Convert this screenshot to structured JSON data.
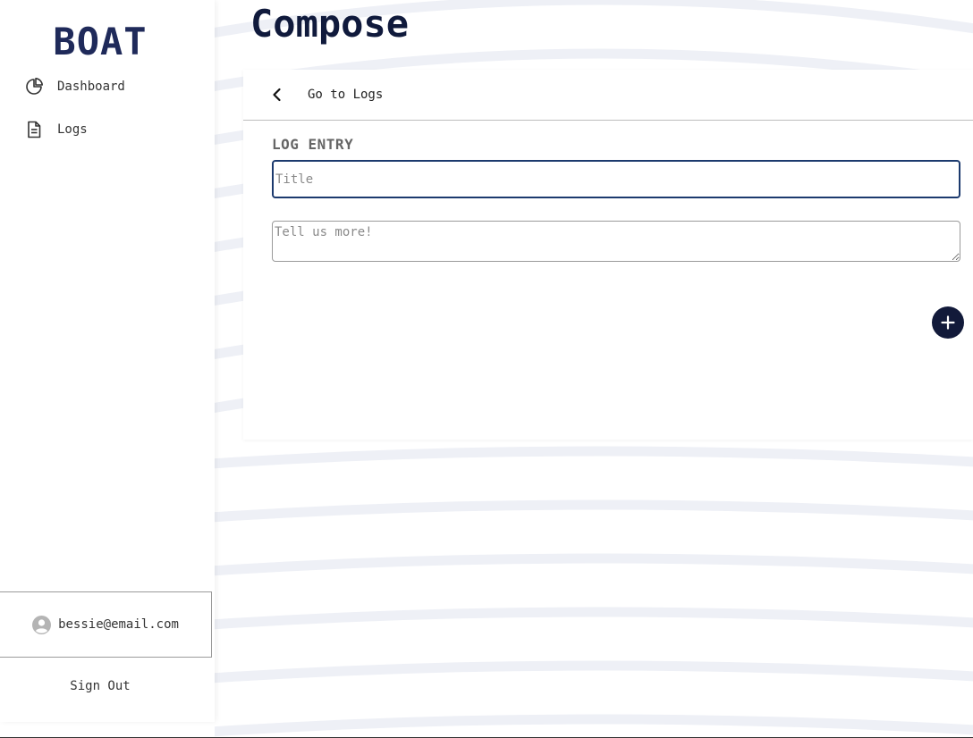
{
  "sidebar": {
    "brand": "BOAT",
    "nav": [
      {
        "label": "Dashboard",
        "icon": "pie-chart-icon"
      },
      {
        "label": "Logs",
        "icon": "document-icon"
      }
    ],
    "user": {
      "email": "bessie@email.com",
      "icon": "user-circle-icon"
    },
    "sign_out_label": "Sign Out"
  },
  "main": {
    "page_title": "Compose",
    "back_link_label": "Go to Logs",
    "section_label": "LOG ENTRY",
    "title_input": {
      "placeholder": "Title",
      "value": ""
    },
    "body_input": {
      "placeholder": "Tell us more!",
      "value": ""
    },
    "add_button_icon": "plus-icon"
  },
  "colors": {
    "brand": "#1f2a5a",
    "title": "#101a3c",
    "accent": "#121a3a",
    "focus_border": "#1c3a6e",
    "wave": "#eef0f6"
  }
}
